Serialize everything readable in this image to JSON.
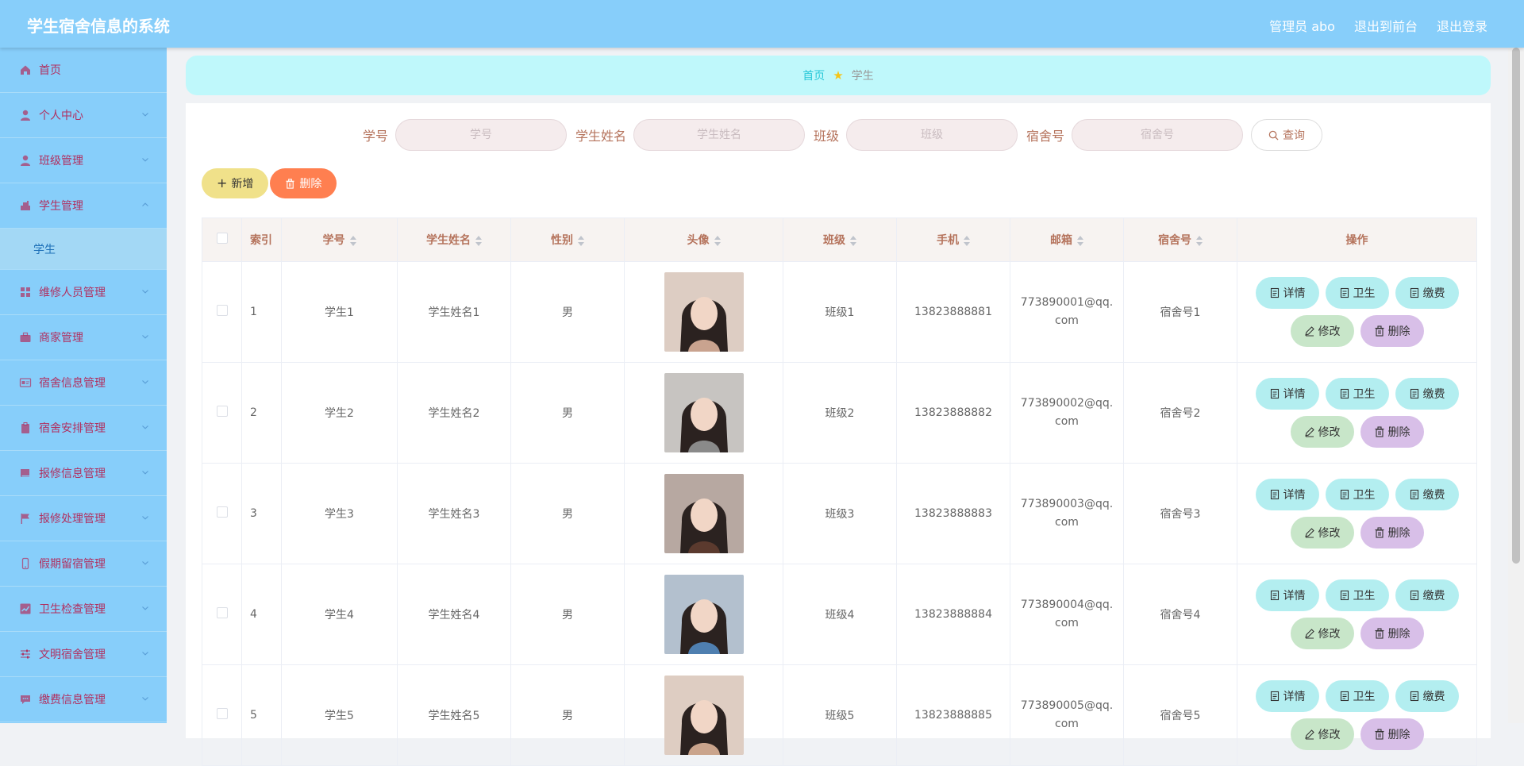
{
  "app": {
    "title": "学生宿舍信息的系统"
  },
  "topbar": {
    "admin_label": "管理员 abo",
    "to_front": "退出到前台",
    "logout": "退出登录"
  },
  "sidebar": {
    "items": [
      {
        "label": "首页",
        "icon": "home-icon"
      },
      {
        "label": "个人中心",
        "icon": "user-icon"
      },
      {
        "label": "班级管理",
        "icon": "user-icon"
      },
      {
        "label": "学生管理",
        "icon": "student-icon",
        "expanded": true
      },
      {
        "label": "维修人员管理",
        "icon": "grid-icon"
      },
      {
        "label": "商家管理",
        "icon": "briefcase-icon"
      },
      {
        "label": "宿舍信息管理",
        "icon": "card-icon"
      },
      {
        "label": "宿舍安排管理",
        "icon": "clipboard-icon"
      },
      {
        "label": "报修信息管理",
        "icon": "book-icon"
      },
      {
        "label": "报修处理管理",
        "icon": "flag-icon"
      },
      {
        "label": "假期留宿管理",
        "icon": "phone-icon"
      },
      {
        "label": "卫生检查管理",
        "icon": "chart-icon"
      },
      {
        "label": "文明宿舍管理",
        "icon": "sliders-icon"
      },
      {
        "label": "缴费信息管理",
        "icon": "chat-icon"
      }
    ],
    "submenu": {
      "label": "学生"
    }
  },
  "breadcrumb": {
    "home": "首页",
    "current": "学生"
  },
  "search": {
    "fields": [
      {
        "label": "学号",
        "placeholder": "学号"
      },
      {
        "label": "学生姓名",
        "placeholder": "学生姓名"
      },
      {
        "label": "班级",
        "placeholder": "班级"
      },
      {
        "label": "宿舍号",
        "placeholder": "宿舍号"
      }
    ],
    "button": "查询"
  },
  "actions": {
    "add": "新增",
    "delete": "删除"
  },
  "table": {
    "headers": [
      "索引",
      "学号",
      "学生姓名",
      "性别",
      "头像",
      "班级",
      "手机",
      "邮箱",
      "宿舍号",
      "操作"
    ],
    "row_buttons": {
      "detail": "详情",
      "hygiene": "卫生",
      "fee": "缴费",
      "edit": "修改",
      "delete": "删除"
    },
    "rows": [
      {
        "index": "1",
        "id": "学生1",
        "name": "学生姓名1",
        "gender": "男",
        "class": "班级1",
        "phone": "13823888881",
        "email": "773890001@qq.com",
        "dorm": "宿舍号1",
        "avatar_tone": "#c9a38f"
      },
      {
        "index": "2",
        "id": "学生2",
        "name": "学生姓名2",
        "gender": "男",
        "class": "班级2",
        "phone": "13823888882",
        "email": "773890002@qq.com",
        "dorm": "宿舍号2",
        "avatar_tone": "#8a8a8a"
      },
      {
        "index": "3",
        "id": "学生3",
        "name": "学生姓名3",
        "gender": "男",
        "class": "班级3",
        "phone": "13823888883",
        "email": "773890003@qq.com",
        "dorm": "宿舍号3",
        "avatar_tone": "#5b3a2e"
      },
      {
        "index": "4",
        "id": "学生4",
        "name": "学生姓名4",
        "gender": "男",
        "class": "班级4",
        "phone": "13823888884",
        "email": "773890004@qq.com",
        "dorm": "宿舍号4",
        "avatar_tone": "#4f7fb0"
      },
      {
        "index": "5",
        "id": "学生5",
        "name": "学生姓名5",
        "gender": "男",
        "class": "班级5",
        "phone": "13823888885",
        "email": "773890005@qq.com",
        "dorm": "宿舍号5",
        "avatar_tone": "#caa48c"
      }
    ]
  }
}
